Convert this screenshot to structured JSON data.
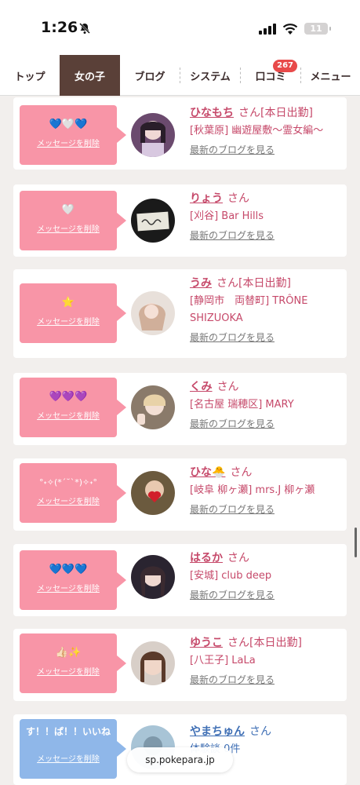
{
  "status": {
    "time": "1:26",
    "battery": "11"
  },
  "nav": {
    "tabs": [
      {
        "label": "トップ"
      },
      {
        "label": "女の子"
      },
      {
        "label": "ブログ"
      },
      {
        "label": "システム"
      },
      {
        "label": "口コミ",
        "badge": "267"
      },
      {
        "label": "メニュー"
      }
    ]
  },
  "cards": [
    {
      "message": "💙🤍💙",
      "delete": "メッセージを削除",
      "name": "ひなもち",
      "honorific": "さん",
      "tag": "[本日出勤]",
      "shop": "[秋葉原] 幽遊屋敷～霊女編～",
      "blog": "最新のブログを見る"
    },
    {
      "message": "🤍",
      "delete": "メッセージを削除",
      "name": "りょう",
      "honorific": "さん",
      "tag": "",
      "shop": "[刈谷] Bar Hills",
      "blog": "最新のブログを見る"
    },
    {
      "message": "⭐",
      "delete": "メッセージを削除",
      "name": "うみ",
      "honorific": "さん",
      "tag": "[本日出勤]",
      "shop": "[静岡市　両替町] TRÔNE SHIZUOKA",
      "blog": "最新のブログを見る"
    },
    {
      "message": "💜💜💜",
      "delete": "メッセージを削除",
      "name": "くみ",
      "honorific": "さん",
      "tag": "",
      "shop": "[名古屋 瑞穂区] MARY",
      "blog": "最新のブログを見る"
    },
    {
      "message": "°˖✧(*´˘`*)✧˖°",
      "delete": "メッセージを削除",
      "name": "ひな🐣",
      "honorific": "さん",
      "tag": "",
      "shop": "[岐阜 柳ヶ瀬] mrs.J 柳ヶ瀬",
      "blog": "最新のブログを見る"
    },
    {
      "message": "💙💙💙",
      "delete": "メッセージを削除",
      "name": "はるか",
      "honorific": "さん",
      "tag": "",
      "shop": "[安城] club deep",
      "blog": "最新のブログを見る"
    },
    {
      "message": "👍🏻✨",
      "delete": "メッセージを削除",
      "name": "ゆうこ",
      "honorific": "さん",
      "tag": "[本日出勤]",
      "shop": "[八王子] LaLa",
      "blog": "最新のブログを見る"
    },
    {
      "message": "す！！ぱ！！いいね",
      "delete": "メッセージを削除",
      "name": "やまちゅん",
      "honorific": "さん",
      "tag": "",
      "shop": "体験談 0件",
      "blog": ""
    }
  ],
  "url_bar": "sp.pokepara.jp",
  "colors": {
    "pink": "#f895a7",
    "blue": "#8fb7e9",
    "accent": "#c6496a",
    "nav_active": "#5a4038"
  }
}
